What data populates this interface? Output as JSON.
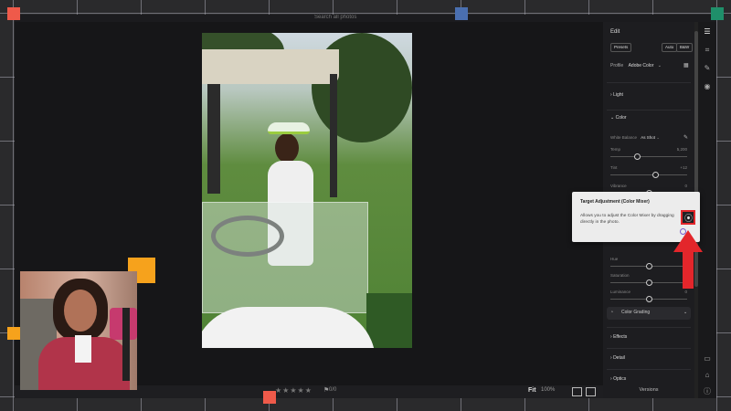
{
  "topbar": {
    "search_placeholder": "Search all photos"
  },
  "panel": {
    "title": "Edit",
    "presets_label": "Presets",
    "auto_label": "Auto",
    "bw_label": "B&W",
    "profile_label": "Profile",
    "profile_value": "Adobe Color",
    "sections": {
      "light": "Light",
      "color": "Color",
      "effects": "Effects",
      "detail": "Detail",
      "optics": "Optics"
    },
    "white_balance_label": "White Balance",
    "white_balance_value": "As Shot",
    "sliders": [
      {
        "label": "Temp",
        "value": "5,200",
        "level": 0.35
      },
      {
        "label": "Tint",
        "value": "+12",
        "level": 0.58
      },
      {
        "label": "Vibrance",
        "value": "0",
        "level": 0.5
      },
      {
        "label": "Saturation",
        "value": "0",
        "level": 0.5
      }
    ],
    "mixer_sliders": [
      {
        "label": "Hue",
        "value": "0",
        "level": 0.5
      },
      {
        "label": "Saturation",
        "value": "0",
        "level": 0.5
      },
      {
        "label": "Luminance",
        "value": "0",
        "level": 0.5
      }
    ],
    "color_grading_label": "Color Grading",
    "versions_label": "Versions"
  },
  "tooltip": {
    "title": "Target Adjustment (Color Mixer)",
    "body": "Allows you to adjust the Color Mixer by dragging directly in the photo."
  },
  "bottombar": {
    "stars": "★★★★★",
    "flag_count": "0/0",
    "fit_label": "Fit",
    "zoom_value": "100%"
  },
  "colors": {
    "accent_red": "#e3262b",
    "marker_orange": "#f6a21c",
    "marker_blue": "#4a6fb0",
    "marker_green": "#1f8f6a",
    "marker_coral": "#ef5a4a"
  },
  "icons": [
    "sliders-icon",
    "crop-icon",
    "healing-icon",
    "masking-icon",
    "comment-icon",
    "tag-icon",
    "info-icon",
    "eyedropper-icon",
    "target-adjustment-icon"
  ]
}
